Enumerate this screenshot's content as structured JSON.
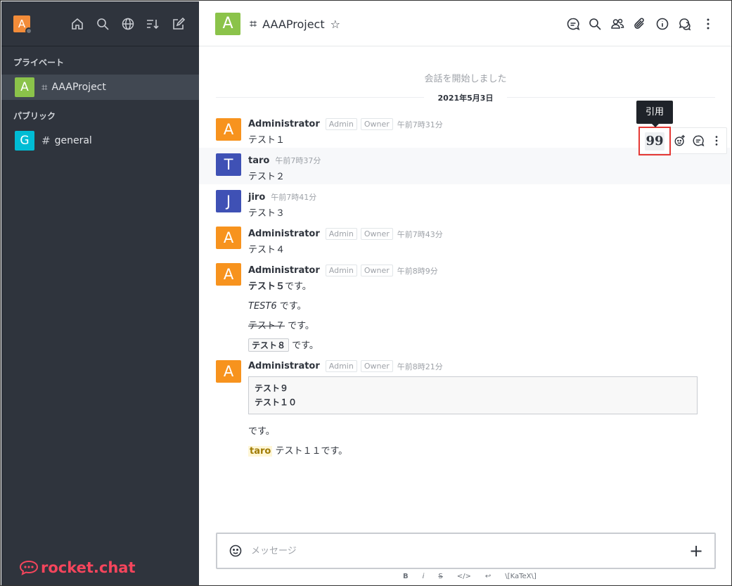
{
  "sidebar": {
    "user_initial": "A",
    "sections": [
      {
        "label": "プライベート"
      },
      {
        "label": "パブリック"
      }
    ],
    "rooms": [
      {
        "initial": "A",
        "name": "AAAProject",
        "color": "#8bc34a",
        "icon": "lock-hash-icon"
      },
      {
        "initial": "G",
        "name": "general",
        "color": "#00bcd4",
        "icon": "hash-icon"
      }
    ],
    "brand": "rocket.chat"
  },
  "header": {
    "initial": "A",
    "title": "AAAProject"
  },
  "system_message": "会話を開始しました",
  "date_divider": "2021年5月3日",
  "tooltip": "引用",
  "messages": [
    {
      "initial": "A",
      "user": "Administrator",
      "tags": [
        "Admin",
        "Owner"
      ],
      "time": "午前7時31分",
      "color": "#f7931e",
      "lines": [
        "テスト１"
      ]
    },
    {
      "initial": "T",
      "user": "taro",
      "tags": [],
      "time": "午前7時37分",
      "color": "#3f51b5",
      "lines": [
        "テスト２"
      ]
    },
    {
      "initial": "J",
      "user": "jiro",
      "tags": [],
      "time": "午前7時41分",
      "color": "#3f51b5",
      "lines": [
        "テスト３"
      ]
    },
    {
      "initial": "A",
      "user": "Administrator",
      "tags": [
        "Admin",
        "Owner"
      ],
      "time": "午前7時43分",
      "color": "#f7931e",
      "lines": [
        "テスト４"
      ]
    },
    {
      "initial": "A",
      "user": "Administrator",
      "tags": [
        "Admin",
        "Owner"
      ],
      "time": "午前8時9分",
      "color": "#f7931e",
      "rich": {
        "bold": "テスト５",
        "bold_tail": "です。",
        "italic": "TEST6",
        "italic_tail": " です。",
        "strike": "テスト７",
        "strike_tail": " です。",
        "code": "テスト８",
        "code_tail": " です。"
      }
    },
    {
      "initial": "A",
      "user": "Administrator",
      "tags": [
        "Admin",
        "Owner"
      ],
      "time": "午前8時21分",
      "color": "#f7931e",
      "codeblock": [
        "テスト９",
        "テスト１０"
      ],
      "after": "です。",
      "mention": "taro",
      "mention_tail": " テスト１１です。"
    }
  ],
  "composer": {
    "placeholder": "メッセージ"
  },
  "format_bar": [
    "B",
    "i",
    "S",
    "</>",
    "↩",
    "\\[KaTeX\\]"
  ]
}
